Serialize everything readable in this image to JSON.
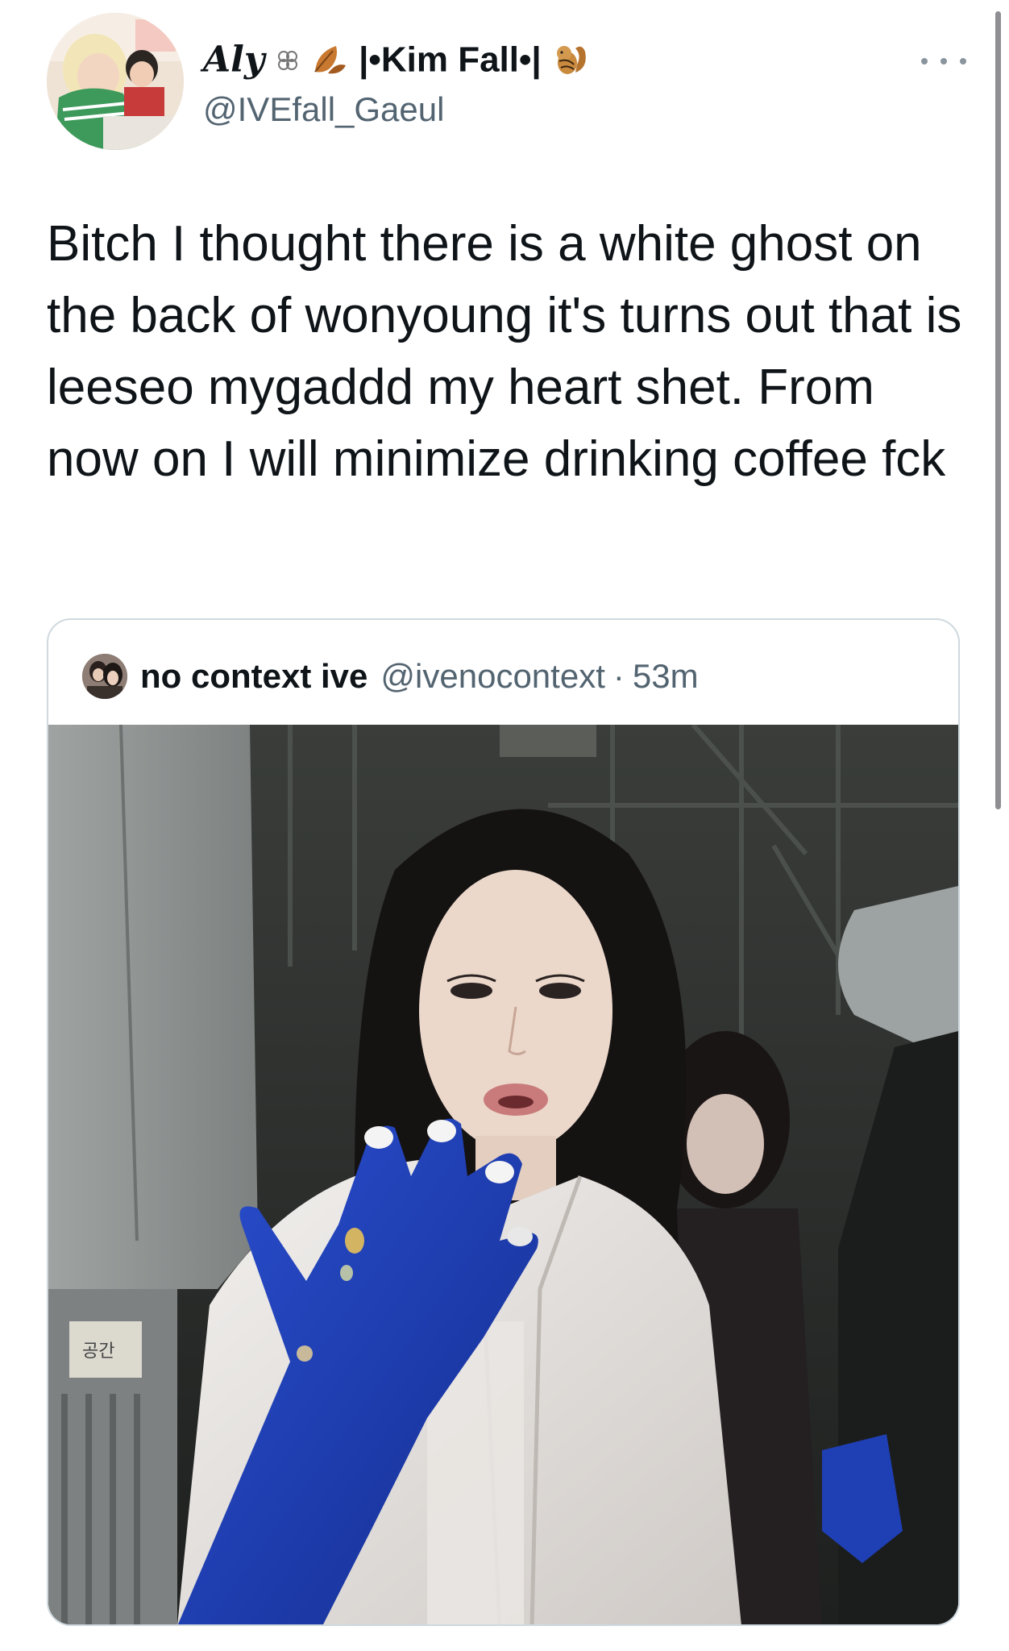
{
  "tweet": {
    "author": {
      "name_prefix": "Aly",
      "name_suffix": "|•Kim Fall•|",
      "name_emojis": [
        "clover-icon",
        "leaf-icon",
        "chipmunk-icon"
      ],
      "handle": "@IVEfall_Gaeul"
    },
    "text": "Bitch I thought there is a white ghost on the back of wonyoung it's turns out that is leeseo mygaddd my heart shet. From now on I will minimize drinking coffee fck",
    "more_icon": "more-horizontal-icon"
  },
  "quoted_tweet": {
    "author_name": "no context ive",
    "author_handle": "@ivenocontext",
    "separator": "·",
    "time": "53m",
    "media_sign_text": "공간"
  },
  "colors": {
    "text_primary": "#0f1419",
    "text_secondary": "#536471",
    "border": "#cfd9de",
    "glove_blue": "#1f3fb5"
  }
}
